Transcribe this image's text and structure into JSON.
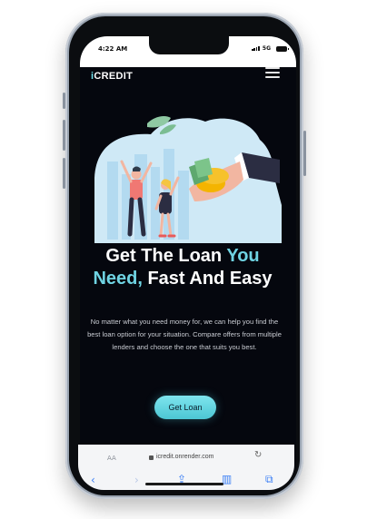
{
  "status": {
    "time": "4:22 AM",
    "network": "5G"
  },
  "brand": {
    "prefix": "i",
    "name": "CREDIT"
  },
  "hero": {
    "headline": {
      "line1_a": "Get The Loan ",
      "line1_b": "You",
      "line2_a": "Need,",
      "line2_b": " Fast And Easy"
    },
    "description": "No matter what you need money for, we can help you find the best loan option for your situation. Compare offers from multiple lenders and choose the one that suits you best.",
    "cta_label": "Get Loan"
  },
  "browser": {
    "text_size": "AA",
    "url": "icredit.onrender.com"
  },
  "colors": {
    "accent": "#6fd3e2",
    "background": "#05070e",
    "button": "#5ccfdc"
  },
  "icons": [
    "menu-icon",
    "lock-icon",
    "reload-icon",
    "back-icon",
    "forward-icon",
    "share-icon",
    "bookmarks-icon",
    "tabs-icon"
  ]
}
